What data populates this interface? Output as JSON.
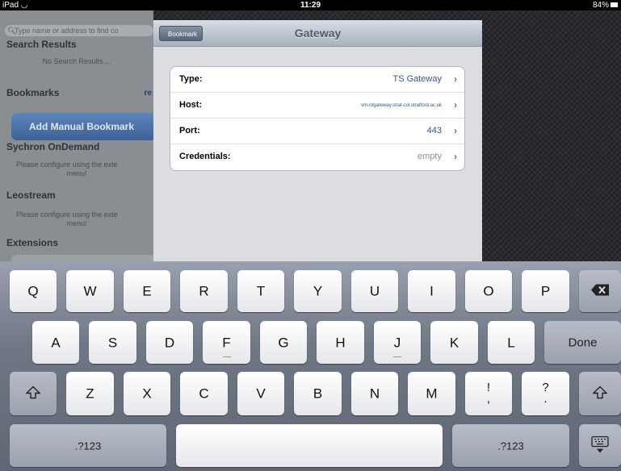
{
  "status_bar": {
    "carrier": "iPad",
    "wifi": "wifi-icon",
    "time": "11:29",
    "battery": "84%"
  },
  "sidebar": {
    "search_placeholder": "Type name or address to find co",
    "search_results_heading": "Search Results",
    "no_results": "No Search Results ...",
    "bookmarks_heading": "Bookmarks",
    "bookmarks_link": "re",
    "add_button": "Add Manual Bookmark",
    "sychron_heading": "Sychron OnDemand",
    "sychron_text": "Please configure using the exte",
    "sychron_text2": "menu!",
    "leostream_heading": "Leostream",
    "leostream_text": "Please configure using the exte",
    "leostream_text2": "menu!",
    "extensions_heading": "Extensions"
  },
  "panel": {
    "back_label": "Bookmark",
    "title": "Gateway",
    "rows": [
      {
        "label": "Type:",
        "value": "TS Gateway"
      },
      {
        "label": "Host:",
        "value": "vm-rdgateway.strat-col.stratford.ac.uk"
      },
      {
        "label": "Port:",
        "value": "443"
      },
      {
        "label": "Credentials:",
        "value": "empty"
      }
    ]
  },
  "keyboard": {
    "row1": [
      "Q",
      "W",
      "E",
      "R",
      "T",
      "Y",
      "U",
      "I",
      "O",
      "P"
    ],
    "row2": [
      "A",
      "S",
      "D",
      "F",
      "G",
      "H",
      "J",
      "K",
      "L"
    ],
    "row3": [
      "Z",
      "X",
      "C",
      "V",
      "B",
      "N",
      "M"
    ],
    "done": "Done",
    "excl": "!",
    "comma": ",",
    "question": "?",
    "period": ".",
    "numbers_left": ".?123",
    "numbers_right": ".?123",
    "icons": {
      "backspace": "backspace-icon",
      "shift": "shift-icon",
      "hide": "keyboard-hide-icon"
    }
  }
}
